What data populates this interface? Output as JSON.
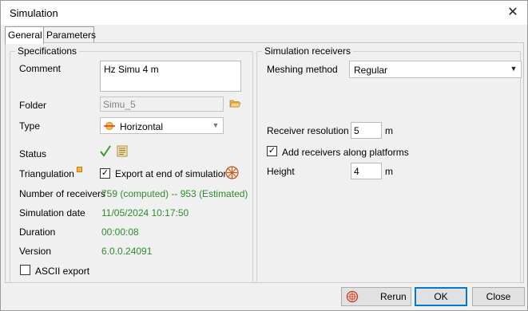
{
  "window": {
    "title": "Simulation",
    "close_glyph": "✕"
  },
  "tabs": [
    {
      "label": "General"
    },
    {
      "label": "Parameters"
    }
  ],
  "specifications": {
    "title": "Specifications",
    "comment_label": "Comment",
    "comment_value": "Hz Simu 4 m",
    "folder_label": "Folder",
    "folder_value": "Simu_5",
    "type_label": "Type",
    "type_value": "Horizontal",
    "status_label": "Status",
    "triangulation_label": "Triangulation",
    "export_label": "Export at end of simulation",
    "export_checked": true,
    "receivers_label": "Number of receivers",
    "receivers_value": "759 (computed) -- 953 (Estimated)",
    "date_label": "Simulation date",
    "date_value": "11/05/2024 10:17:50",
    "duration_label": "Duration",
    "duration_value": "00:00:08",
    "version_label": "Version",
    "version_value": "6.0.0.24091",
    "ascii_label": "ASCII export",
    "ascii_checked": false
  },
  "receivers": {
    "title": "Simulation receivers",
    "meshing_label": "Meshing method",
    "meshing_value": "Regular",
    "resolution_label": "Receiver resolution",
    "resolution_value": "5",
    "resolution_unit": "m",
    "platforms_label": "Add receivers along platforms",
    "platforms_checked": true,
    "height_label": "Height",
    "height_value": "4",
    "height_unit": "m"
  },
  "buttons": {
    "rerun": "Rerun",
    "ok": "OK",
    "close": "Close"
  },
  "colors": {
    "green_text": "#2e8b2e",
    "accent": "#0078d7"
  }
}
